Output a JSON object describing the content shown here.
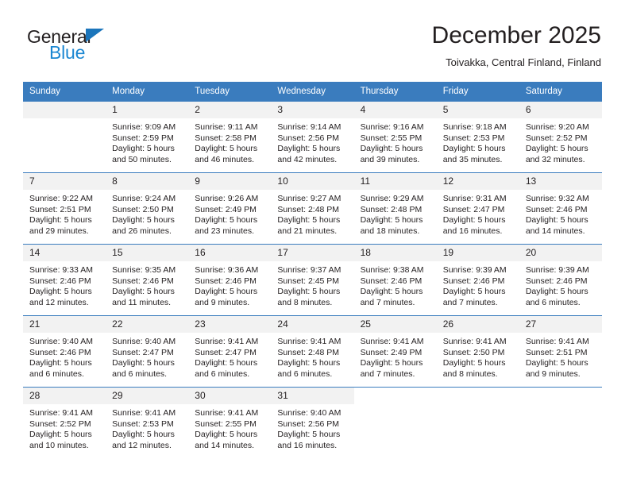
{
  "brand": {
    "name_top": "General",
    "name_bottom": "Blue",
    "accent_color": "#1b87d2",
    "triangle_color": "#1b75bb",
    "text_color": "#231f20"
  },
  "header": {
    "month_title": "December 2025",
    "location": "Toivakka, Central Finland, Finland"
  },
  "theme": {
    "header_row_bg": "#3a7cbe",
    "header_row_text": "#ffffff",
    "daynum_bg": "#f2f2f2",
    "row_divider": "#3a7cbe",
    "body_text": "#231f20"
  },
  "weekday_headers": [
    "Sunday",
    "Monday",
    "Tuesday",
    "Wednesday",
    "Thursday",
    "Friday",
    "Saturday"
  ],
  "weeks": [
    {
      "days": [
        {
          "date": "",
          "empty": true,
          "blank": false,
          "sunrise": "",
          "sunset": "",
          "daylight_line1": "",
          "daylight_line2": ""
        },
        {
          "date": "1",
          "empty": false,
          "blank": false,
          "sunrise": "Sunrise: 9:09 AM",
          "sunset": "Sunset: 2:59 PM",
          "daylight_line1": "Daylight: 5 hours",
          "daylight_line2": "and 50 minutes."
        },
        {
          "date": "2",
          "empty": false,
          "blank": false,
          "sunrise": "Sunrise: 9:11 AM",
          "sunset": "Sunset: 2:58 PM",
          "daylight_line1": "Daylight: 5 hours",
          "daylight_line2": "and 46 minutes."
        },
        {
          "date": "3",
          "empty": false,
          "blank": false,
          "sunrise": "Sunrise: 9:14 AM",
          "sunset": "Sunset: 2:56 PM",
          "daylight_line1": "Daylight: 5 hours",
          "daylight_line2": "and 42 minutes."
        },
        {
          "date": "4",
          "empty": false,
          "blank": false,
          "sunrise": "Sunrise: 9:16 AM",
          "sunset": "Sunset: 2:55 PM",
          "daylight_line1": "Daylight: 5 hours",
          "daylight_line2": "and 39 minutes."
        },
        {
          "date": "5",
          "empty": false,
          "blank": false,
          "sunrise": "Sunrise: 9:18 AM",
          "sunset": "Sunset: 2:53 PM",
          "daylight_line1": "Daylight: 5 hours",
          "daylight_line2": "and 35 minutes."
        },
        {
          "date": "6",
          "empty": false,
          "blank": false,
          "sunrise": "Sunrise: 9:20 AM",
          "sunset": "Sunset: 2:52 PM",
          "daylight_line1": "Daylight: 5 hours",
          "daylight_line2": "and 32 minutes."
        }
      ]
    },
    {
      "days": [
        {
          "date": "7",
          "empty": false,
          "blank": false,
          "sunrise": "Sunrise: 9:22 AM",
          "sunset": "Sunset: 2:51 PM",
          "daylight_line1": "Daylight: 5 hours",
          "daylight_line2": "and 29 minutes."
        },
        {
          "date": "8",
          "empty": false,
          "blank": false,
          "sunrise": "Sunrise: 9:24 AM",
          "sunset": "Sunset: 2:50 PM",
          "daylight_line1": "Daylight: 5 hours",
          "daylight_line2": "and 26 minutes."
        },
        {
          "date": "9",
          "empty": false,
          "blank": false,
          "sunrise": "Sunrise: 9:26 AM",
          "sunset": "Sunset: 2:49 PM",
          "daylight_line1": "Daylight: 5 hours",
          "daylight_line2": "and 23 minutes."
        },
        {
          "date": "10",
          "empty": false,
          "blank": false,
          "sunrise": "Sunrise: 9:27 AM",
          "sunset": "Sunset: 2:48 PM",
          "daylight_line1": "Daylight: 5 hours",
          "daylight_line2": "and 21 minutes."
        },
        {
          "date": "11",
          "empty": false,
          "blank": false,
          "sunrise": "Sunrise: 9:29 AM",
          "sunset": "Sunset: 2:48 PM",
          "daylight_line1": "Daylight: 5 hours",
          "daylight_line2": "and 18 minutes."
        },
        {
          "date": "12",
          "empty": false,
          "blank": false,
          "sunrise": "Sunrise: 9:31 AM",
          "sunset": "Sunset: 2:47 PM",
          "daylight_line1": "Daylight: 5 hours",
          "daylight_line2": "and 16 minutes."
        },
        {
          "date": "13",
          "empty": false,
          "blank": false,
          "sunrise": "Sunrise: 9:32 AM",
          "sunset": "Sunset: 2:46 PM",
          "daylight_line1": "Daylight: 5 hours",
          "daylight_line2": "and 14 minutes."
        }
      ]
    },
    {
      "days": [
        {
          "date": "14",
          "empty": false,
          "blank": false,
          "sunrise": "Sunrise: 9:33 AM",
          "sunset": "Sunset: 2:46 PM",
          "daylight_line1": "Daylight: 5 hours",
          "daylight_line2": "and 12 minutes."
        },
        {
          "date": "15",
          "empty": false,
          "blank": false,
          "sunrise": "Sunrise: 9:35 AM",
          "sunset": "Sunset: 2:46 PM",
          "daylight_line1": "Daylight: 5 hours",
          "daylight_line2": "and 11 minutes."
        },
        {
          "date": "16",
          "empty": false,
          "blank": false,
          "sunrise": "Sunrise: 9:36 AM",
          "sunset": "Sunset: 2:46 PM",
          "daylight_line1": "Daylight: 5 hours",
          "daylight_line2": "and 9 minutes."
        },
        {
          "date": "17",
          "empty": false,
          "blank": false,
          "sunrise": "Sunrise: 9:37 AM",
          "sunset": "Sunset: 2:45 PM",
          "daylight_line1": "Daylight: 5 hours",
          "daylight_line2": "and 8 minutes."
        },
        {
          "date": "18",
          "empty": false,
          "blank": false,
          "sunrise": "Sunrise: 9:38 AM",
          "sunset": "Sunset: 2:46 PM",
          "daylight_line1": "Daylight: 5 hours",
          "daylight_line2": "and 7 minutes."
        },
        {
          "date": "19",
          "empty": false,
          "blank": false,
          "sunrise": "Sunrise: 9:39 AM",
          "sunset": "Sunset: 2:46 PM",
          "daylight_line1": "Daylight: 5 hours",
          "daylight_line2": "and 7 minutes."
        },
        {
          "date": "20",
          "empty": false,
          "blank": false,
          "sunrise": "Sunrise: 9:39 AM",
          "sunset": "Sunset: 2:46 PM",
          "daylight_line1": "Daylight: 5 hours",
          "daylight_line2": "and 6 minutes."
        }
      ]
    },
    {
      "days": [
        {
          "date": "21",
          "empty": false,
          "blank": false,
          "sunrise": "Sunrise: 9:40 AM",
          "sunset": "Sunset: 2:46 PM",
          "daylight_line1": "Daylight: 5 hours",
          "daylight_line2": "and 6 minutes."
        },
        {
          "date": "22",
          "empty": false,
          "blank": false,
          "sunrise": "Sunrise: 9:40 AM",
          "sunset": "Sunset: 2:47 PM",
          "daylight_line1": "Daylight: 5 hours",
          "daylight_line2": "and 6 minutes."
        },
        {
          "date": "23",
          "empty": false,
          "blank": false,
          "sunrise": "Sunrise: 9:41 AM",
          "sunset": "Sunset: 2:47 PM",
          "daylight_line1": "Daylight: 5 hours",
          "daylight_line2": "and 6 minutes."
        },
        {
          "date": "24",
          "empty": false,
          "blank": false,
          "sunrise": "Sunrise: 9:41 AM",
          "sunset": "Sunset: 2:48 PM",
          "daylight_line1": "Daylight: 5 hours",
          "daylight_line2": "and 6 minutes."
        },
        {
          "date": "25",
          "empty": false,
          "blank": false,
          "sunrise": "Sunrise: 9:41 AM",
          "sunset": "Sunset: 2:49 PM",
          "daylight_line1": "Daylight: 5 hours",
          "daylight_line2": "and 7 minutes."
        },
        {
          "date": "26",
          "empty": false,
          "blank": false,
          "sunrise": "Sunrise: 9:41 AM",
          "sunset": "Sunset: 2:50 PM",
          "daylight_line1": "Daylight: 5 hours",
          "daylight_line2": "and 8 minutes."
        },
        {
          "date": "27",
          "empty": false,
          "blank": false,
          "sunrise": "Sunrise: 9:41 AM",
          "sunset": "Sunset: 2:51 PM",
          "daylight_line1": "Daylight: 5 hours",
          "daylight_line2": "and 9 minutes."
        }
      ]
    },
    {
      "days": [
        {
          "date": "28",
          "empty": false,
          "blank": false,
          "sunrise": "Sunrise: 9:41 AM",
          "sunset": "Sunset: 2:52 PM",
          "daylight_line1": "Daylight: 5 hours",
          "daylight_line2": "and 10 minutes."
        },
        {
          "date": "29",
          "empty": false,
          "blank": false,
          "sunrise": "Sunrise: 9:41 AM",
          "sunset": "Sunset: 2:53 PM",
          "daylight_line1": "Daylight: 5 hours",
          "daylight_line2": "and 12 minutes."
        },
        {
          "date": "30",
          "empty": false,
          "blank": false,
          "sunrise": "Sunrise: 9:41 AM",
          "sunset": "Sunset: 2:55 PM",
          "daylight_line1": "Daylight: 5 hours",
          "daylight_line2": "and 14 minutes."
        },
        {
          "date": "31",
          "empty": false,
          "blank": false,
          "sunrise": "Sunrise: 9:40 AM",
          "sunset": "Sunset: 2:56 PM",
          "daylight_line1": "Daylight: 5 hours",
          "daylight_line2": "and 16 minutes."
        },
        {
          "date": "",
          "empty": false,
          "blank": true,
          "sunrise": "",
          "sunset": "",
          "daylight_line1": "",
          "daylight_line2": ""
        },
        {
          "date": "",
          "empty": false,
          "blank": true,
          "sunrise": "",
          "sunset": "",
          "daylight_line1": "",
          "daylight_line2": ""
        },
        {
          "date": "",
          "empty": false,
          "blank": true,
          "sunrise": "",
          "sunset": "",
          "daylight_line1": "",
          "daylight_line2": ""
        }
      ]
    }
  ]
}
